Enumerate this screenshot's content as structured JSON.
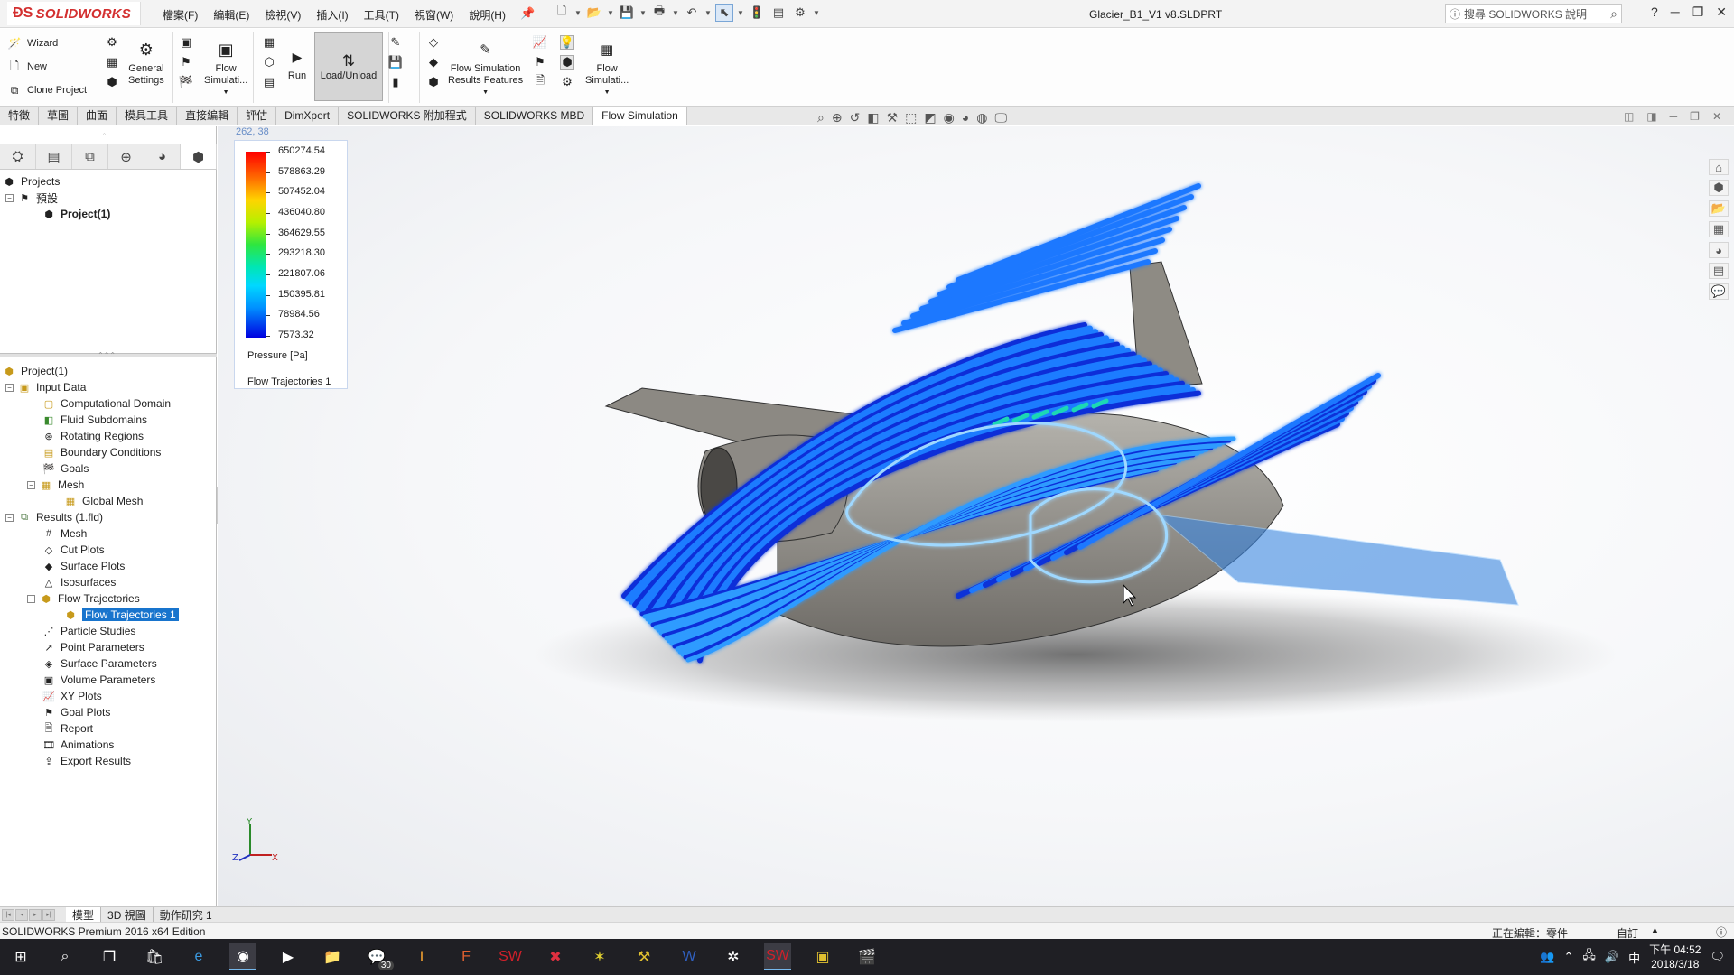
{
  "app": {
    "brand": "SOLIDWORKS",
    "document_title": "Glacier_B1_V1 v8.SLDPRT",
    "help_search_placeholder": "搜尋 SOLIDWORKS 說明"
  },
  "menu": [
    "檔案(F)",
    "編輯(E)",
    "檢視(V)",
    "插入(I)",
    "工具(T)",
    "視窗(W)",
    "說明(H)"
  ],
  "ribbon": {
    "wizard": "Wizard",
    "new": "New",
    "clone_project": "Clone Project",
    "general_settings_l1": "General",
    "general_settings_l2": "Settings",
    "flow_sim_l1": "Flow",
    "flow_sim_l2": "Simulati...",
    "run": "Run",
    "load_unload": "Load/Unload",
    "results_features_l1": "Flow Simulation",
    "results_features_l2": "Results Features",
    "flow_sim2_l1": "Flow",
    "flow_sim2_l2": "Simulati..."
  },
  "tabs": [
    "特徵",
    "草圖",
    "曲面",
    "模具工具",
    "直接編輯",
    "評估",
    "DimXpert",
    "SOLIDWORKS 附加程式",
    "SOLIDWORKS MBD",
    "Flow Simulation"
  ],
  "active_tab": "Flow Simulation",
  "project_tree": {
    "root": "Projects",
    "default": "預設",
    "project": "Project(1)"
  },
  "analysis_tree": {
    "root": "Project(1)",
    "input_data": "Input Data",
    "input_items": [
      "Computational Domain",
      "Fluid Subdomains",
      "Rotating Regions",
      "Boundary Conditions",
      "Goals"
    ],
    "mesh": "Mesh",
    "global_mesh": "Global Mesh",
    "results": "Results (1.fld)",
    "result_items_a": [
      "Mesh",
      "Cut Plots",
      "Surface Plots",
      "Isosurfaces"
    ],
    "flow_trajectories": "Flow Trajectories",
    "flow_trajectories_1": "Flow Trajectories 1",
    "result_items_b": [
      "Particle Studies",
      "Point Parameters",
      "Surface Parameters",
      "Volume Parameters",
      "XY Plots",
      "Goal Plots",
      "Report",
      "Animations",
      "Export Results"
    ]
  },
  "viewport": {
    "coords": "262, 38",
    "legend_values": [
      "650274.54",
      "578863.29",
      "507452.04",
      "436040.80",
      "364629.55",
      "293218.30",
      "221807.06",
      "150395.81",
      "78984.56",
      "7573.32"
    ],
    "legend_unit": "Pressure [Pa]",
    "legend_title": "Flow Trajectories 1",
    "axis_y": "Y",
    "axis_x": "X",
    "axis_z": "Z"
  },
  "bottom_tabs": [
    "模型",
    "3D 視圖",
    "動作研究 1"
  ],
  "status": {
    "edition": "SOLIDWORKS Premium 2016 x64 Edition",
    "editing": "正在編輯：零件",
    "custom": "自訂"
  },
  "taskbar": {
    "line_badge": "30",
    "ime": "中",
    "time": "下午 04:52",
    "date": "2018/3/18"
  },
  "colors": {
    "brand_red": "#d32f2f",
    "selection_blue": "#1874cd",
    "trajectory_blue": "#1e78ff"
  }
}
